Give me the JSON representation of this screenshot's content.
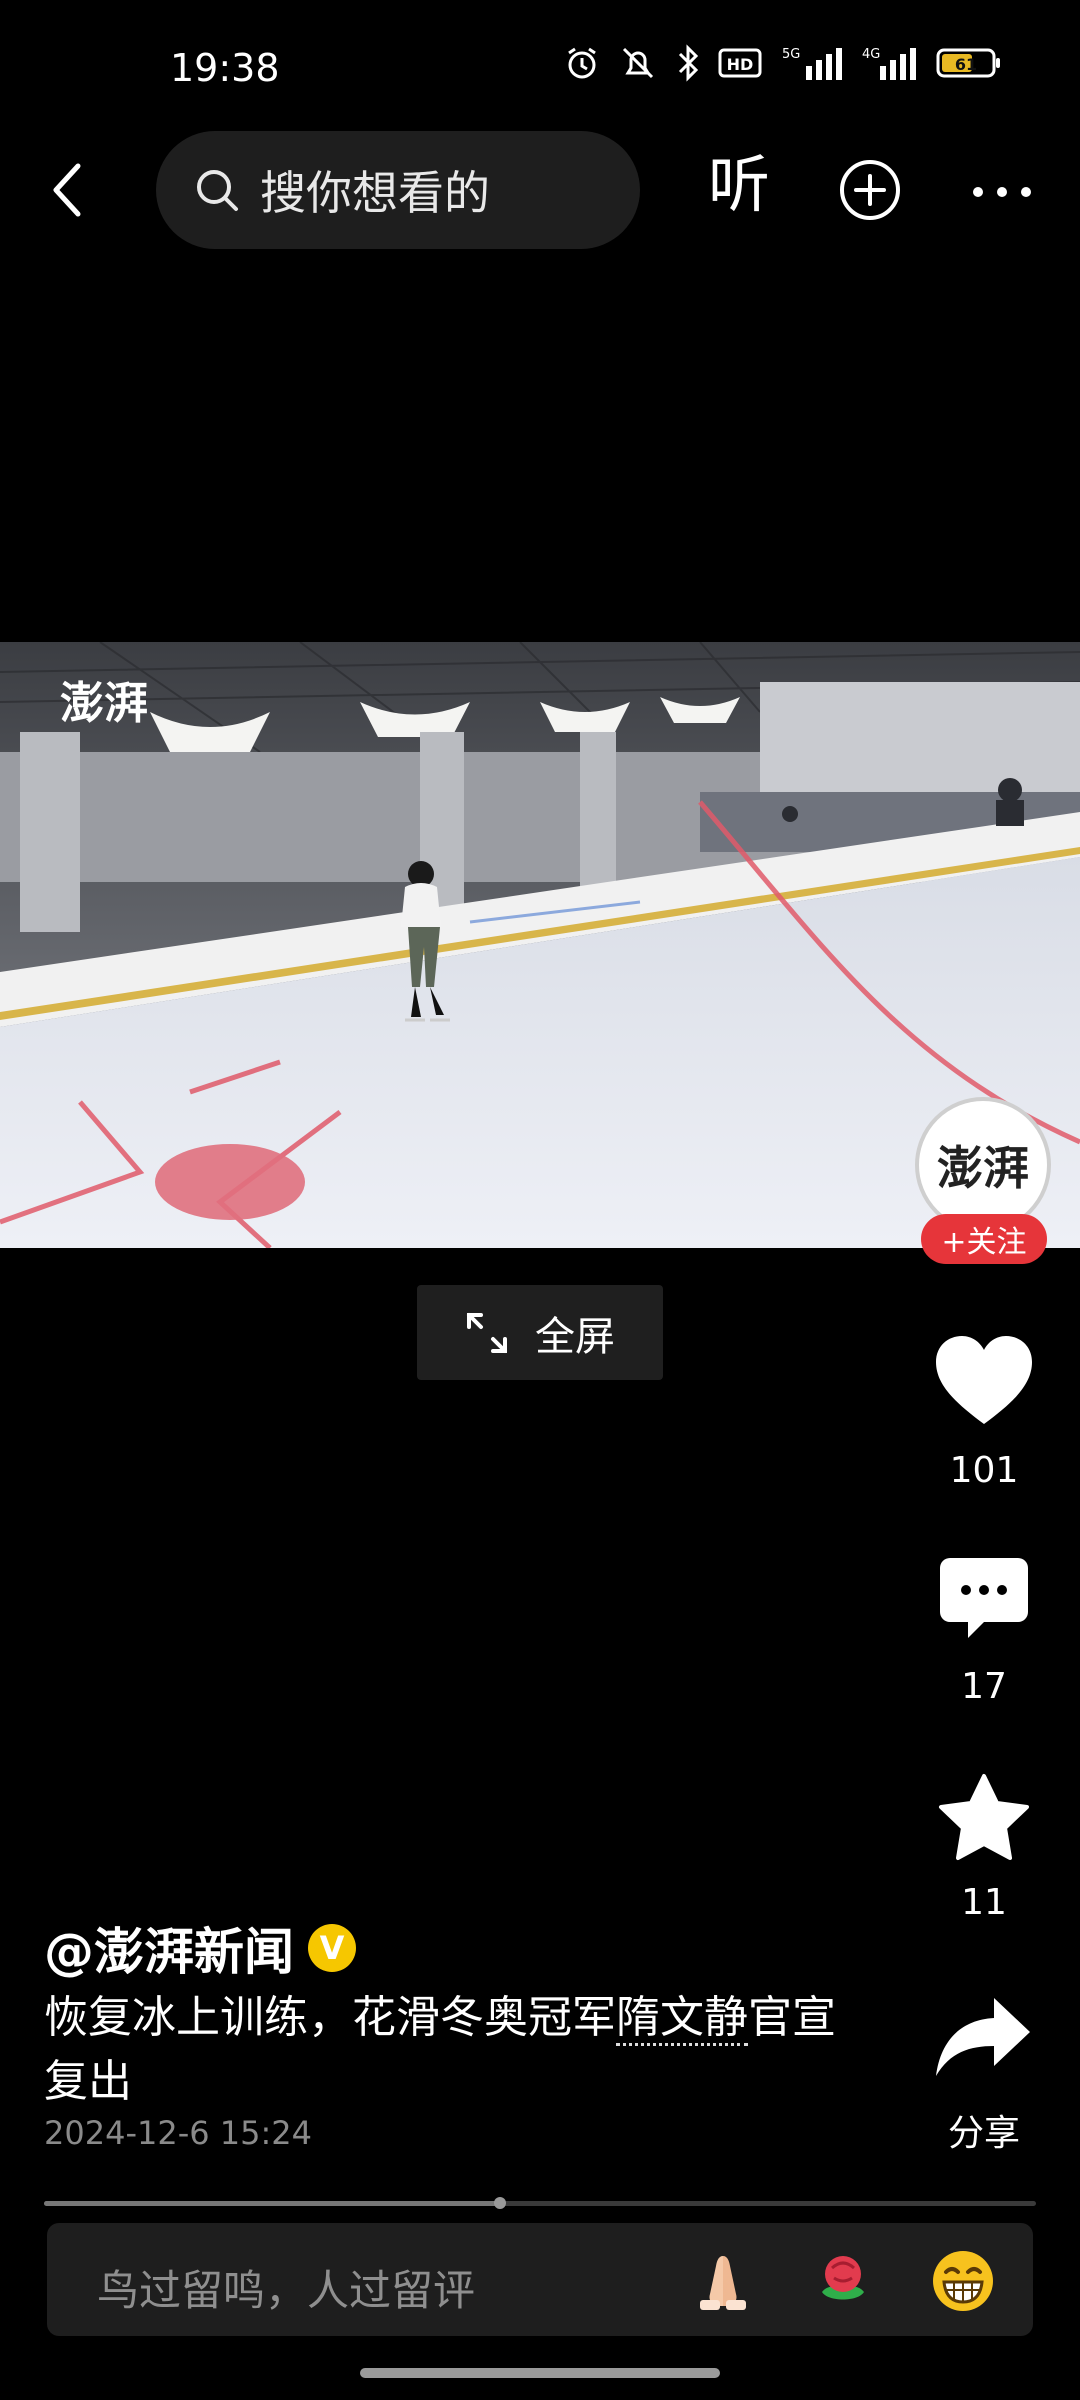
{
  "status_bar": {
    "time": "19:38",
    "network_1": "5G",
    "network_2": "4G",
    "hd": "HD",
    "battery": "61"
  },
  "top_nav": {
    "search_placeholder": "搜你想看的",
    "listen_label": "听"
  },
  "video": {
    "watermark_text": "澎湃",
    "fullscreen_label": "全屏"
  },
  "author": {
    "avatar_text": "澎湃",
    "follow_label": "+关注",
    "name": "@澎湃新闻",
    "verified_mark": "V"
  },
  "actions": {
    "likes": "101",
    "comments": "17",
    "favorites": "11",
    "share_label": "分享"
  },
  "caption": {
    "text_before": "恢复冰上训练，花滑冬奥冠军",
    "tagged_name": "隋文静",
    "text_after": "官宣复出",
    "timestamp": "2024-12-6 15:24"
  },
  "progress": {
    "played_fraction": 0.46
  },
  "comment_bar": {
    "placeholder": "鸟过留鸣，人过留评",
    "emojis": [
      "pray-emoji",
      "rose-emoji",
      "grin-emoji"
    ]
  },
  "colors": {
    "background": "#000000",
    "follow_red": "#e6353a",
    "verified_yellow": "#f6c700"
  }
}
